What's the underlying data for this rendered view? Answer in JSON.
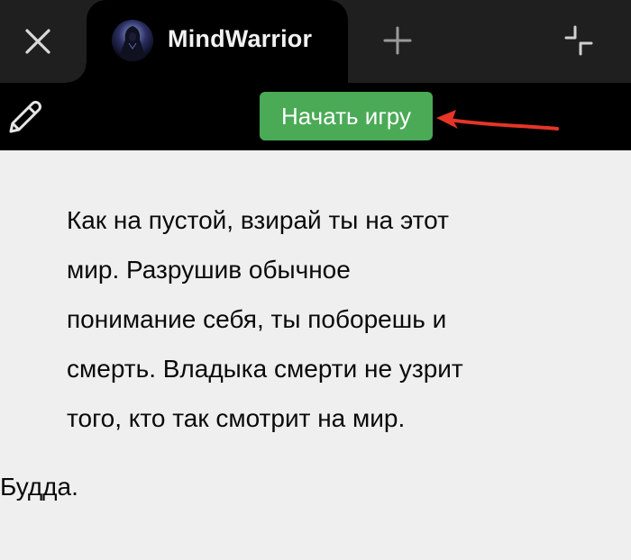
{
  "window": {
    "tab": {
      "title": "MindWarrior",
      "avatar_icon": "hooded-warrior-avatar"
    },
    "icons": {
      "close": "close-icon",
      "new_tab": "plus-icon",
      "collapse": "collapse-icon"
    }
  },
  "toolbar": {
    "edit_icon": "pencil-icon",
    "start_button_label": "Начать игру",
    "start_button_color": "#4aaa56",
    "annotation_arrow_color": "#e53527"
  },
  "content": {
    "quote_lines": [
      "Как на пустой, взирай ты на этот",
      "мир. Разрушив обычное",
      "понимание себя, ты поборешь и",
      "смерть. Владыка смерти не узрит",
      "того, кто так смотрит на мир."
    ],
    "author": "Будда."
  },
  "colors": {
    "tabstrip_bg": "#1f1f1f",
    "toolbar_bg": "#000000",
    "content_bg": "#efefef"
  }
}
